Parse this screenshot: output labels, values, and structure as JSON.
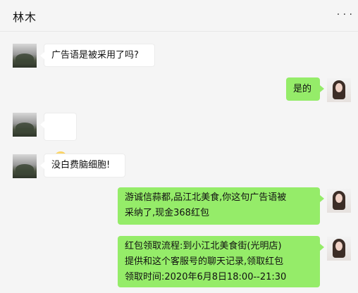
{
  "header": {
    "title": "林木",
    "more_label": "· · ·"
  },
  "messages": [
    {
      "side": "in",
      "text": "广告语是被采用了吗?"
    },
    {
      "side": "out",
      "text": "是的"
    },
    {
      "side": "in",
      "type": "emoji",
      "icon": "smiling-face-emoji"
    },
    {
      "side": "in",
      "text": "没白费脑细胞!"
    },
    {
      "side": "out",
      "text": "游诚信蒜都,品江北美食,你这句广告语被\n采纳了,现金368红包"
    },
    {
      "side": "out",
      "text": "红包领取流程:到小江北美食街(光明店)\n提供和这个客服号的聊天记录,领取红包\n领取时间:2020年6月8日18:00--21:30"
    }
  ],
  "colors": {
    "background": "#f5f5f5",
    "incoming_bubble": "#ffffff",
    "outgoing_bubble": "#95ec69"
  }
}
